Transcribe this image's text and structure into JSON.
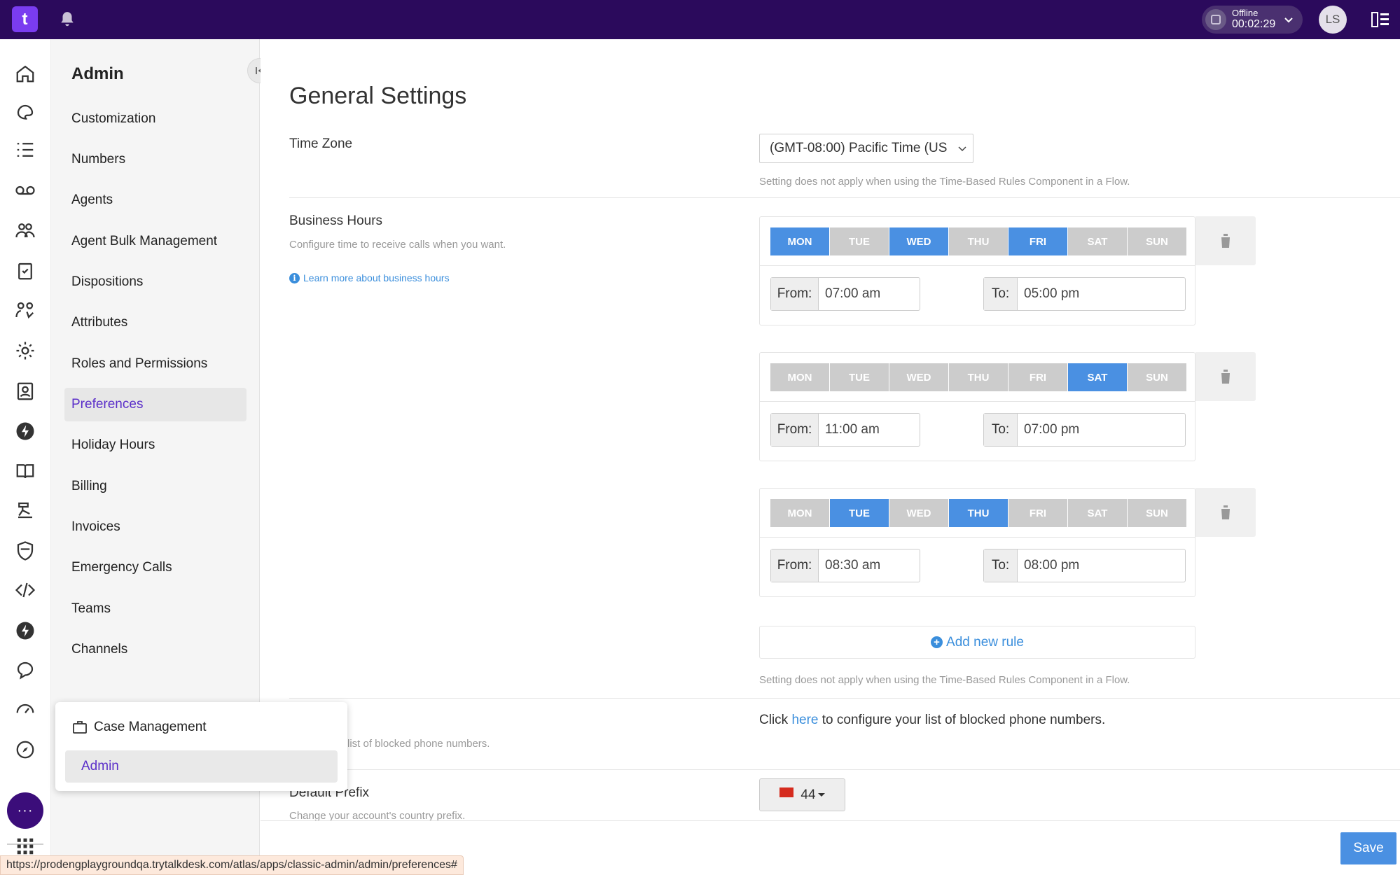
{
  "topbar": {
    "logo_letter": "t",
    "status": {
      "label": "Offline",
      "timer": "00:02:29"
    },
    "user_initials": "LS"
  },
  "rail_icons": [
    "home-icon",
    "palette-icon",
    "list-icon",
    "voicemail-icon",
    "contacts-icon",
    "clipboard-icon",
    "agents-icon",
    "gear-icon",
    "contact-card-icon",
    "bolt-icon",
    "book-icon",
    "flow-icon",
    "shield-icon",
    "code-icon",
    "bolt-alt-icon",
    "chat-icon",
    "gauge-icon",
    "compass-icon"
  ],
  "rail_more_label": "···",
  "sidebar": {
    "title": "Admin",
    "items": [
      {
        "label": "Customization",
        "active": false
      },
      {
        "label": "Numbers",
        "active": false
      },
      {
        "label": "Agents",
        "active": false
      },
      {
        "label": "Agent Bulk Management",
        "active": false
      },
      {
        "label": "Dispositions",
        "active": false
      },
      {
        "label": "Attributes",
        "active": false
      },
      {
        "label": "Roles and Permissions",
        "active": false
      },
      {
        "label": "Preferences",
        "active": true
      },
      {
        "label": "Holiday Hours",
        "active": false
      },
      {
        "label": "Billing",
        "active": false
      },
      {
        "label": "Invoices",
        "active": false
      },
      {
        "label": "Emergency Calls",
        "active": false
      },
      {
        "label": "Teams",
        "active": false
      },
      {
        "label": "Channels",
        "active": false
      }
    ]
  },
  "popup": {
    "case_management": "Case Management",
    "admin": "Admin"
  },
  "main": {
    "title": "General Settings",
    "time_zone": {
      "label": "Time Zone",
      "value": "(GMT-08:00) Pacific Time (US",
      "hint": "Setting does not apply when using the Time-Based Rules Component in a Flow."
    },
    "business_hours": {
      "label": "Business Hours",
      "description": "Configure time to receive calls when you want.",
      "learn_more": "Learn more about business hours",
      "from_label": "From:",
      "to_label": "To:",
      "day_labels": [
        "MON",
        "TUE",
        "WED",
        "THU",
        "FRI",
        "SAT",
        "SUN"
      ],
      "rules": [
        {
          "days_on": [
            true,
            false,
            true,
            false,
            true,
            false,
            false
          ],
          "from": "07:00 am",
          "to": "05:00 pm"
        },
        {
          "days_on": [
            false,
            false,
            false,
            false,
            false,
            true,
            false
          ],
          "from": "11:00 am",
          "to": "07:00 pm"
        },
        {
          "days_on": [
            false,
            true,
            false,
            true,
            false,
            false,
            false
          ],
          "from": "08:30 am",
          "to": "08:00 pm"
        }
      ],
      "add_rule": "Add new rule",
      "hint": "Setting does not apply when using the Time-Based Rules Component in a Flow."
    },
    "blocked": {
      "description_partial": "list of blocked phone numbers.",
      "text_before": "Click ",
      "link": "here",
      "text_after": " to configure your list of blocked phone numbers."
    },
    "default_prefix": {
      "label": "Default Prefix",
      "description": "Change your account's country prefix.",
      "value": "44"
    },
    "save_label": "Save"
  },
  "status_url": "https://prodengplaygroundqa.trytalkdesk.com/atlas/apps/classic-admin/admin/preferences#"
}
